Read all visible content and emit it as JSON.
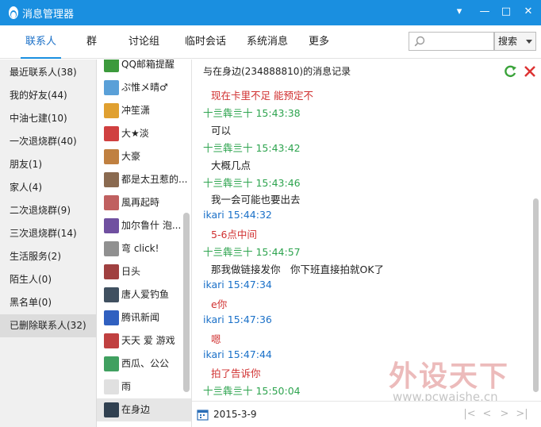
{
  "window": {
    "title": "消息管理器",
    "logo": "qq-penguin-icon"
  },
  "tabs": [
    {
      "label": "联系人",
      "active": true
    },
    {
      "label": "群"
    },
    {
      "label": "讨论组"
    },
    {
      "label": "临时会话"
    },
    {
      "label": "系统消息"
    },
    {
      "label": "更多"
    }
  ],
  "search": {
    "value": "",
    "button_label": "搜索"
  },
  "categories": [
    "最近联系人(38)",
    "我的好友(44)",
    "中油七建(10)",
    "一次退烧群(40)",
    "朋友(1)",
    "家人(4)",
    "二次退烧群(9)",
    "三次退烧群(14)",
    "生活服务(2)",
    "陌生人(0)",
    "黑名单(0)",
    "已删除联系人(32)"
  ],
  "selected_category": 11,
  "contacts": [
    "QQ邮箱提醒",
    "ぷ惟メ晴♂",
    "冲笙潇",
    "大★淡",
    "大豪",
    "都是太丑惹的...",
    "風再起時",
    "加尔鲁什 泡...",
    "弯 click!",
    "日头",
    "唐人爱钓鱼",
    "腾讯新闻",
    "天天 爱 游戏",
    "西瓜、公公",
    "雨",
    "在身边"
  ],
  "selected_contact": 15,
  "chat": {
    "title": "与在身边(234888810)的消息记录",
    "messages": [
      {
        "type": "txt-r",
        "text": "现在卡里不足 能预定不"
      },
      {
        "type": "hdr-g",
        "text": "十亖犇亖十 15:43:38"
      },
      {
        "type": "txt",
        "text": "可以"
      },
      {
        "type": "hdr-g",
        "text": "十亖犇亖十 15:43:42"
      },
      {
        "type": "txt",
        "text": "大概几点"
      },
      {
        "type": "hdr-g",
        "text": "十亖犇亖十 15:43:46"
      },
      {
        "type": "txt",
        "text": "我一会可能也要出去"
      },
      {
        "type": "hdr-b",
        "text": "ikari 15:44:32"
      },
      {
        "type": "txt-r",
        "text": "5-6点中间"
      },
      {
        "type": "hdr-g",
        "text": "十亖犇亖十 15:44:57"
      },
      {
        "type": "txt",
        "text": "那我做链接发你　你下班直接拍就OK了"
      },
      {
        "type": "hdr-b",
        "text": "ikari 15:47:34"
      },
      {
        "type": "txt-r",
        "text": "e你"
      },
      {
        "type": "hdr-b",
        "text": "ikari 15:47:36"
      },
      {
        "type": "txt-r",
        "text": "嗯"
      },
      {
        "type": "hdr-b",
        "text": "ikari 15:47:44"
      },
      {
        "type": "txt-r",
        "text": "拍了告诉你"
      },
      {
        "type": "hdr-g",
        "text": "十亖犇亖十 15:50:04"
      }
    ]
  },
  "footer": {
    "date": "2015-3-9"
  },
  "watermark": {
    "text": "外设天下",
    "url": "www.pcwaishe.cn"
  },
  "colors": {
    "titlebar": "#1a8fe0",
    "accent": "#1a70c8",
    "self_name": "#2ea44f",
    "peer_text": "#d03030"
  }
}
